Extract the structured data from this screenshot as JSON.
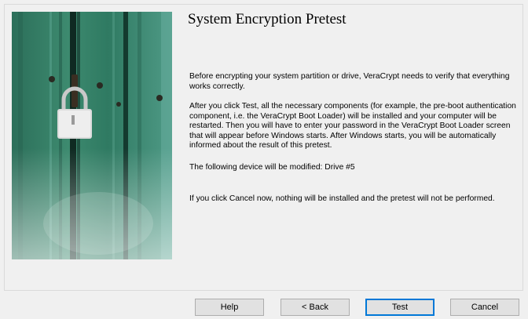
{
  "wizard": {
    "title": "System Encryption Pretest",
    "paragraphs": [
      "Before encrypting your system partition or drive, VeraCrypt needs to verify that everything works correctly.",
      "After you click Test, all the necessary components (for example, the pre-boot authentication component, i.e. the VeraCrypt Boot Loader) will be installed and your computer will be restarted. Then you will have to enter your password in the VeraCrypt Boot Loader screen that will appear before Windows starts. After Windows starts, you will be automatically informed about the result of this pretest.",
      "The following device will be modified: Drive #5",
      "If you click Cancel now, nothing will be installed and the pretest will not be performed."
    ]
  },
  "buttons": {
    "help": "Help",
    "back": "< Back",
    "test": "Test",
    "cancel": "Cancel"
  },
  "colors": {
    "accent": "#0078d7",
    "image_green": "#2f7a62"
  },
  "icons": {
    "side_image": "padlock-on-green-door-image"
  }
}
